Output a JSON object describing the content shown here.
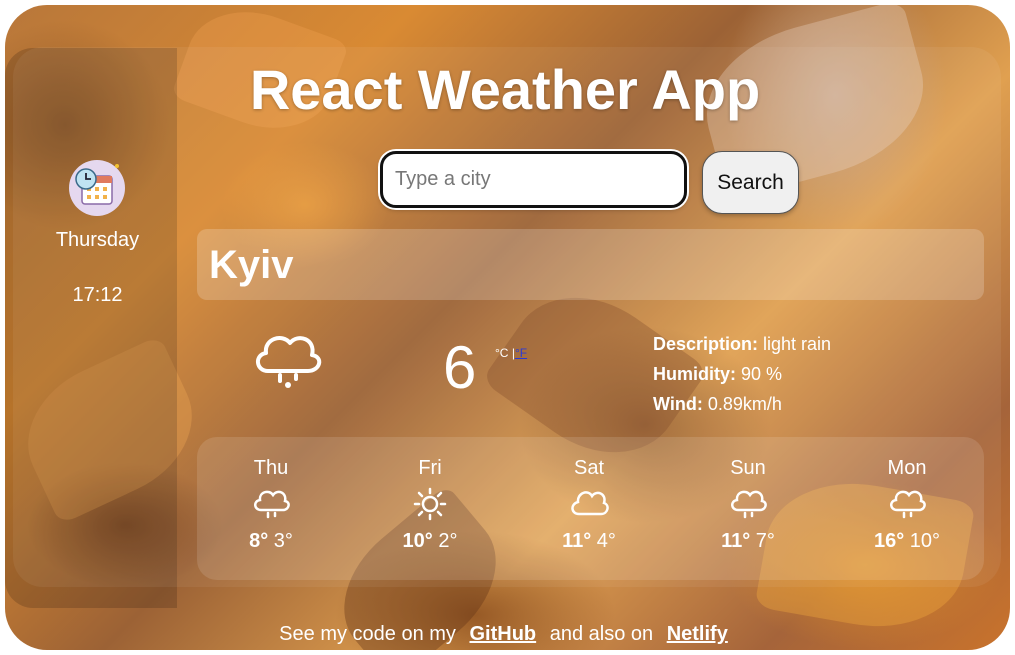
{
  "header": {
    "title": "React Weather App"
  },
  "side": {
    "calendar_icon": "calendar-clock-icon",
    "day": "Thursday",
    "time": "17:12"
  },
  "search": {
    "placeholder": "Type a city",
    "value": "",
    "button_label": "Search"
  },
  "current": {
    "city": "Kyiv",
    "icon": "rain-cloud-icon",
    "temperature": "6",
    "unit_celsius": "°C",
    "unit_separator": "|",
    "unit_fahrenheit": "°F",
    "description_label": "Description:",
    "description_value": "light rain",
    "humidity_label": "Humidity:",
    "humidity_value": "90 %",
    "wind_label": "Wind:",
    "wind_value": "0.89km/h"
  },
  "forecast": [
    {
      "day": "Thu",
      "icon": "rain-cloud-icon",
      "max": "8°",
      "min": "3°"
    },
    {
      "day": "Fri",
      "icon": "sun-icon",
      "max": "10°",
      "min": "2°"
    },
    {
      "day": "Sat",
      "icon": "cloud-icon",
      "max": "11°",
      "min": "4°"
    },
    {
      "day": "Sun",
      "icon": "rain-cloud-icon",
      "max": "11°",
      "min": "7°"
    },
    {
      "day": "Mon",
      "icon": "rain-cloud-icon",
      "max": "16°",
      "min": "10°"
    }
  ],
  "footer": {
    "text_before": "See my code on my",
    "github_label": "GitHub",
    "text_middle": "and also on",
    "netlify_label": "Netlify"
  }
}
